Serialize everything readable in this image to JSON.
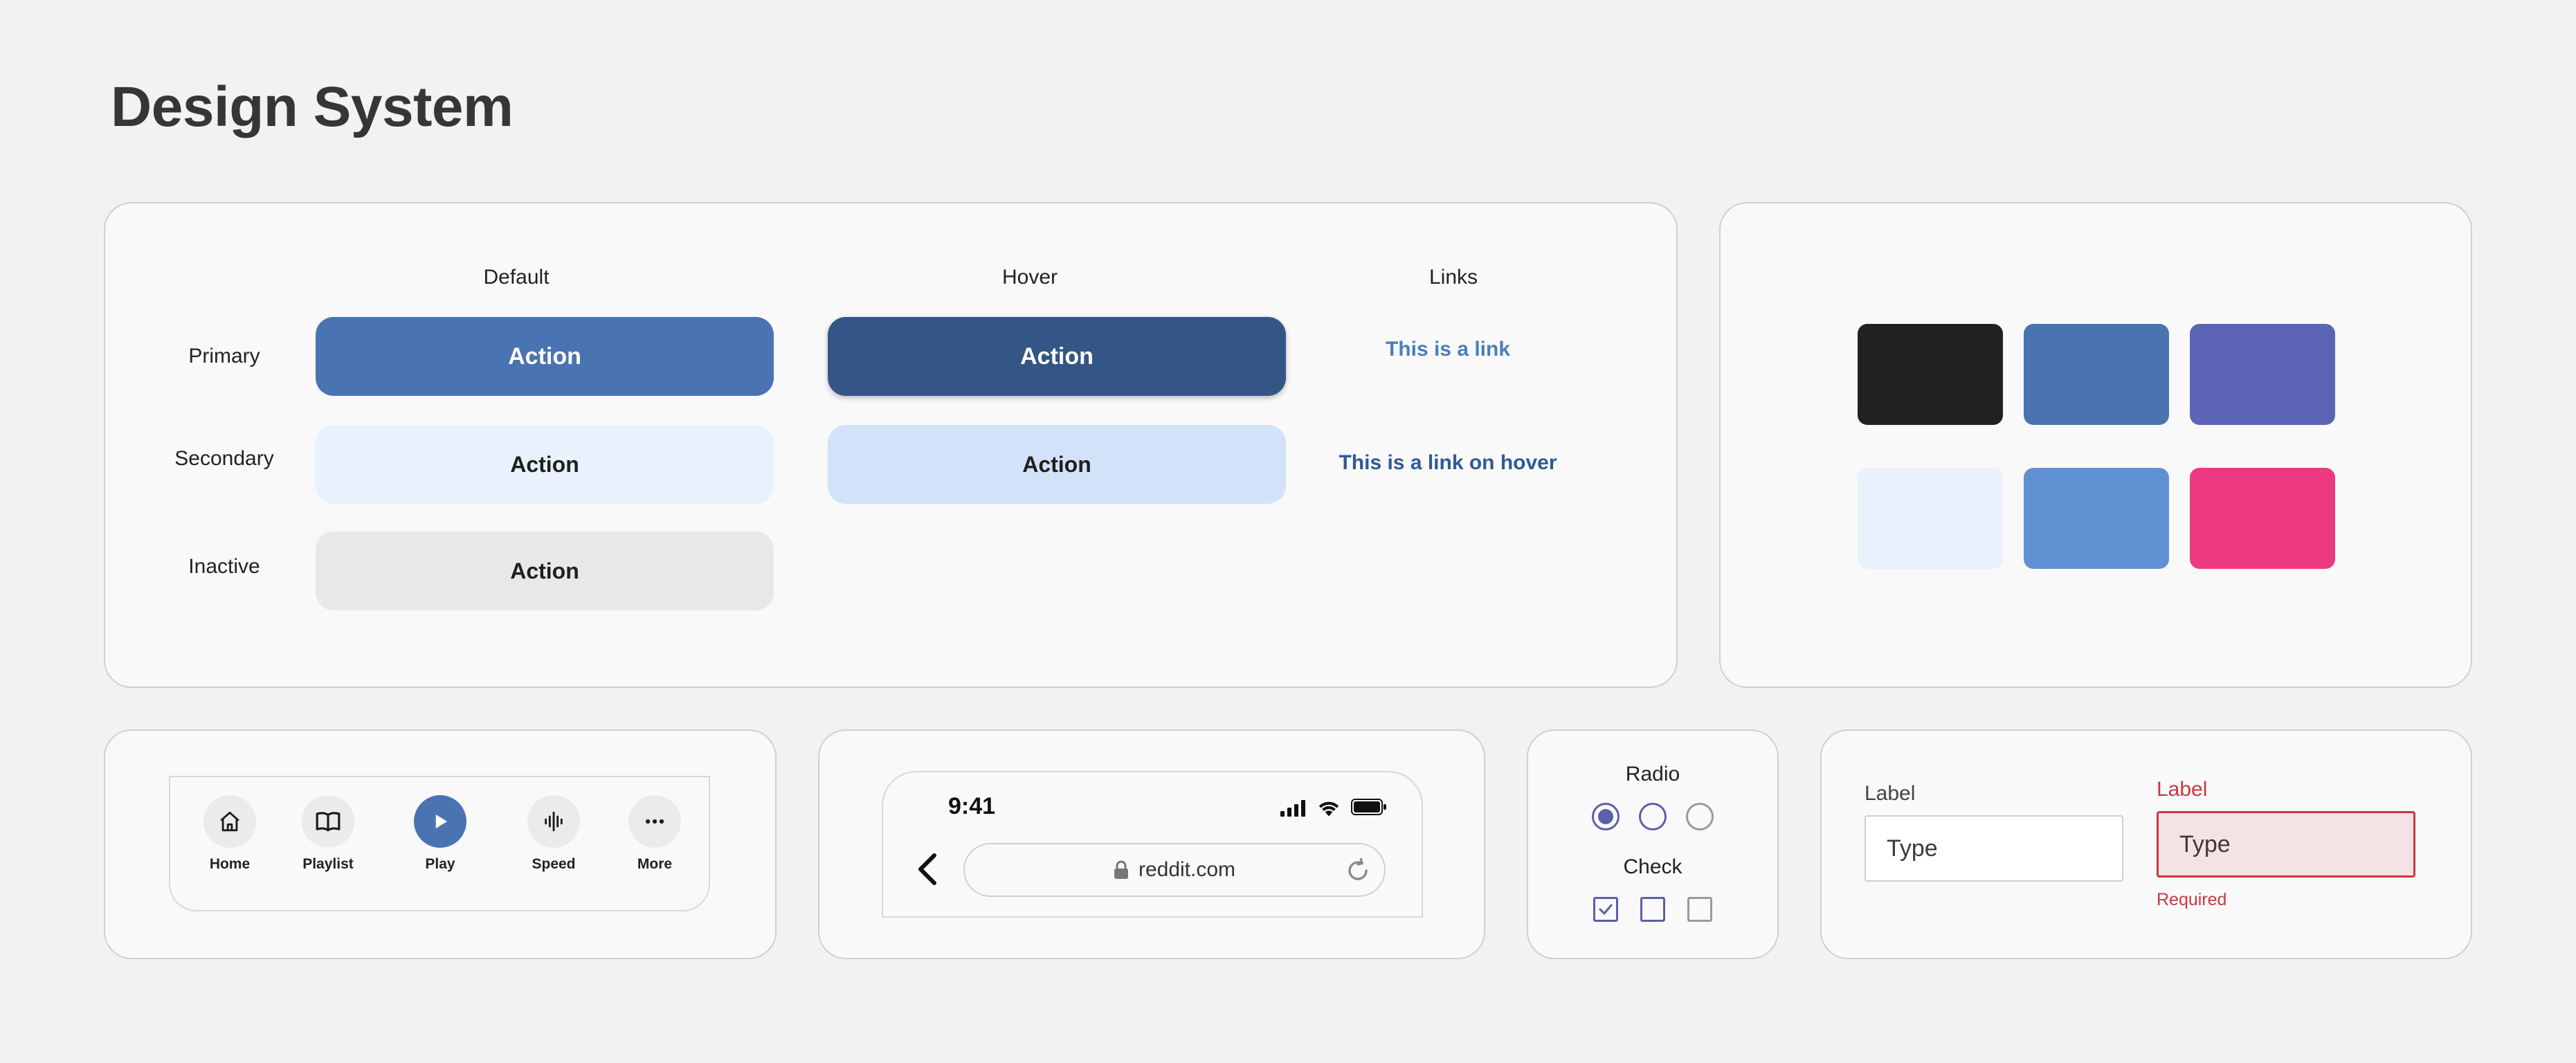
{
  "page": {
    "title": "Design System"
  },
  "buttons_card": {
    "columns": {
      "default": "Default",
      "hover": "Hover",
      "links": "Links"
    },
    "rows": {
      "primary": "Primary",
      "secondary": "Secondary",
      "inactive": "Inactive"
    },
    "primary_default": "Action",
    "primary_hover": "Action",
    "secondary_default": "Action",
    "secondary_hover": "Action",
    "inactive_default": "Action",
    "link_default": "This is a link",
    "link_hover": "This is a link on hover"
  },
  "colors": {
    "swatches": [
      "#212121",
      "#4a73b1",
      "#5c64b5",
      "#e8f1fc",
      "#6190d2",
      "#ed3982"
    ],
    "link_default": "#4a7ec0",
    "link_hover": "#2f5a93",
    "error": "#c8383f",
    "control_accent": "#5b60a8"
  },
  "tabbar": {
    "items": [
      {
        "label": "Home",
        "icon": "home-icon"
      },
      {
        "label": "Playlist",
        "icon": "book-icon"
      },
      {
        "label": "Play",
        "icon": "play-icon",
        "active": true
      },
      {
        "label": "Speed",
        "icon": "waveform-icon"
      },
      {
        "label": "More",
        "icon": "more-icon"
      }
    ]
  },
  "browser": {
    "time": "9:41",
    "url": "reddit.com",
    "icons": [
      "signal-icon",
      "wifi-icon",
      "battery-icon",
      "back-icon",
      "lock-icon",
      "reload-icon"
    ]
  },
  "controls": {
    "radio_label": "Radio",
    "check_label": "Check",
    "radio_selected": 0,
    "check_checked": 0
  },
  "inputs": {
    "normal": {
      "label": "Label",
      "placeholder": "Type"
    },
    "error": {
      "label": "Label",
      "placeholder": "Type",
      "message": "Required"
    }
  }
}
